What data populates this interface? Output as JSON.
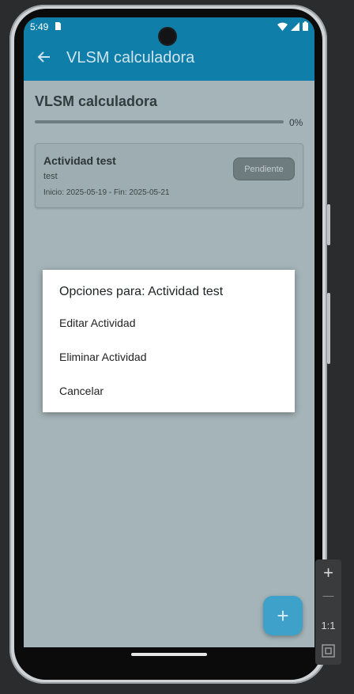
{
  "status_bar": {
    "time": "5:49",
    "icons": [
      "sd-card-icon",
      "wifi-icon",
      "signal-icon",
      "battery-icon"
    ]
  },
  "app_bar": {
    "title": "VLSM calculadora",
    "back_icon": "arrow-left-icon"
  },
  "page": {
    "title": "VLSM calculadora",
    "progress": {
      "value": 0,
      "label": "0%"
    }
  },
  "activity": {
    "title": "Actividad test",
    "description": "test",
    "dates": "Inicio: 2025-05-19 - Fin: 2025-05-21",
    "status": "Pendiente"
  },
  "dialog": {
    "title": "Opciones para: Actividad test",
    "items": [
      "Editar Actividad",
      "Eliminar Actividad",
      "Cancelar"
    ]
  },
  "fab": {
    "label": "+"
  },
  "emulator_toolbar": {
    "zoom_in": "+",
    "zoom_out": "—",
    "actual_size": "1:1"
  },
  "colors": {
    "primary": "#0f7ea9",
    "scrim_bg": "#a4b4b8",
    "fab": "#3ea1c9"
  }
}
